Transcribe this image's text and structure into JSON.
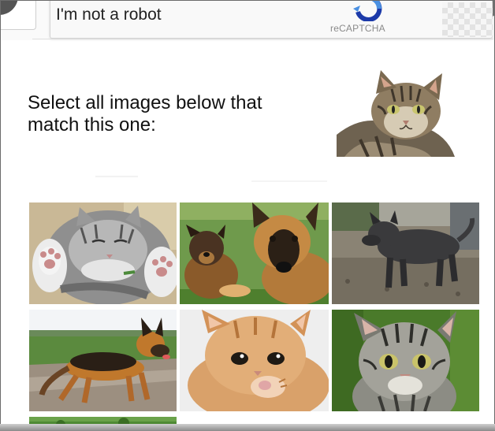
{
  "captcha": {
    "checkbox_label": "I'm not a robot",
    "brand_label": "reCAPTCHA"
  },
  "challenge": {
    "instruction": "Select all images below that match this one:",
    "sample_image": "tabby-cat",
    "tiles": [
      {
        "subject": "kitten-sleeping"
      },
      {
        "subject": "german-shepherd-with-puppy"
      },
      {
        "subject": "black-dog"
      },
      {
        "subject": "german-shepherd-standing"
      },
      {
        "subject": "orange-kitten"
      },
      {
        "subject": "tabby-kitten"
      },
      {
        "subject": "partial-image"
      }
    ]
  },
  "colors": {
    "brand_blue": "#4a90e2",
    "text": "#222222",
    "muted": "#8a8a8a"
  }
}
